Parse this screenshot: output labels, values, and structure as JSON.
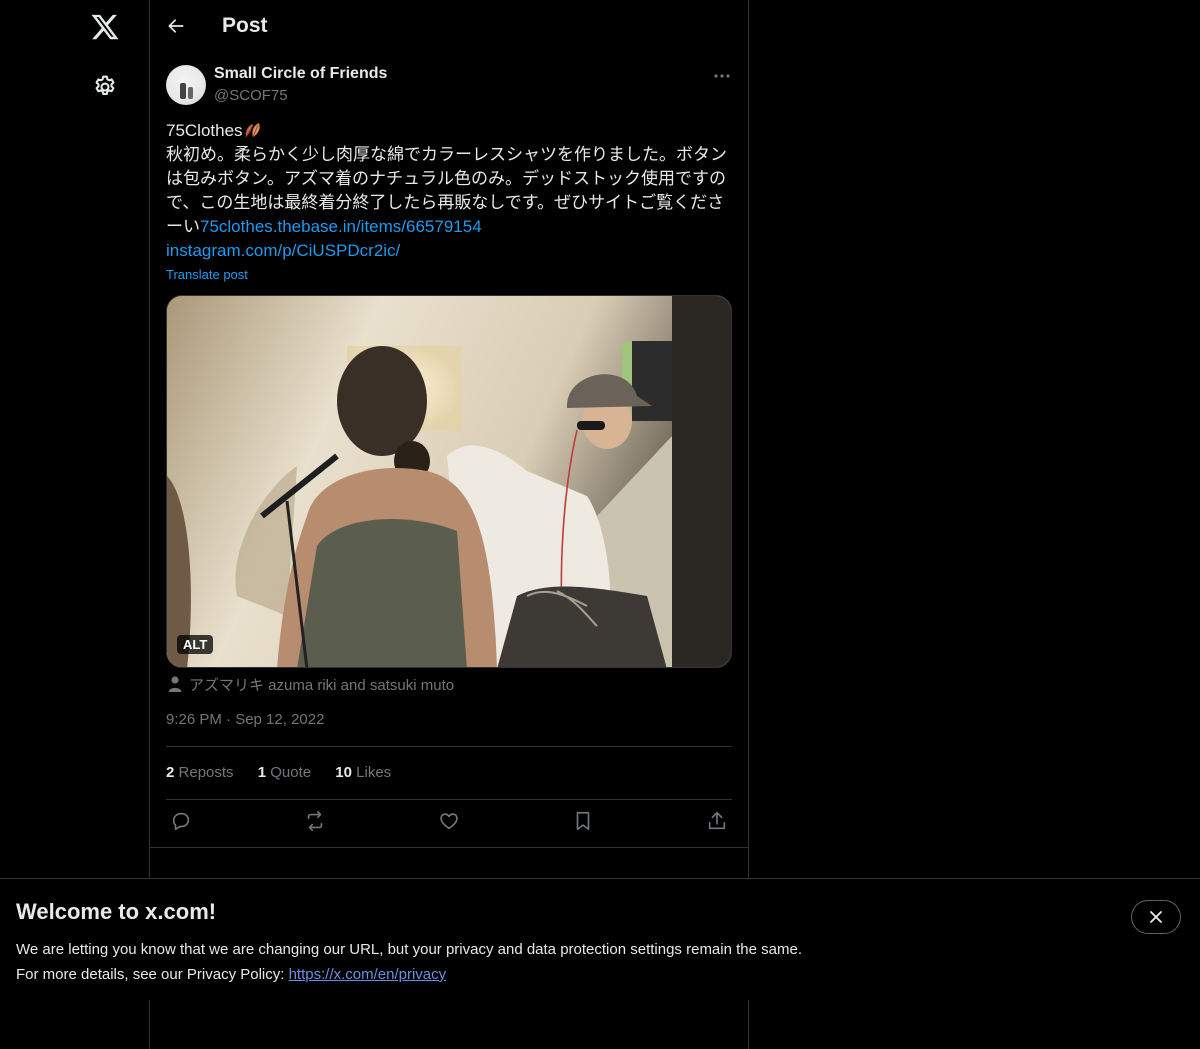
{
  "header": {
    "title": "Post"
  },
  "post": {
    "author": {
      "display_name": "Small Circle of Friends",
      "handle": "@SCOF75"
    },
    "text_lines": [
      "75Clothes",
      "秋初め。柔らかく少し肉厚な綿でカラーレスシャツを作りました。ボタン",
      "は包みボタン。アズマ着のナチュラル色のみ。デッドストック使用ですの",
      "で、この生地は最終着分終了したら再販なしです。ぜひサイトご覧くださ",
      "ーい"
    ],
    "link1": "75clothes.thebase.in/items/66579154",
    "link2": "instagram.com/p/CiUSPDcr2ic/",
    "translate_label": "Translate post",
    "media": {
      "alt_badge": "ALT"
    },
    "tagged_people": "アズマリキ azuma riki and satsuki muto",
    "timestamp": "9:26 PM · Sep 12, 2022",
    "stats": {
      "reposts_count": "2",
      "reposts_label": "Reposts",
      "quotes_count": "1",
      "quotes_label": "Quote",
      "likes_count": "10",
      "likes_label": "Likes"
    }
  },
  "banner": {
    "title": "Welcome to x.com!",
    "line1": "We are letting you know that we are changing our URL, but your privacy and data protection settings remain the same.",
    "line2_prefix": "For more details, see our Privacy Policy: ",
    "privacy_link": "https://x.com/en/privacy"
  },
  "icons": {
    "logo": "x-logo-icon",
    "settings": "gear-icon",
    "back": "arrow-left-icon",
    "more": "more-horizontal-icon",
    "reply": "reply-icon",
    "repost": "repost-icon",
    "like": "heart-icon",
    "bookmark": "bookmark-icon",
    "share": "share-icon",
    "close": "close-icon",
    "person": "person-icon",
    "leaf": "leaf-emoji-icon"
  },
  "colors": {
    "background": "#000000",
    "text": "#e7e9ea",
    "muted": "#71767b",
    "link": "#1d9bf0",
    "border": "#2f3336"
  }
}
